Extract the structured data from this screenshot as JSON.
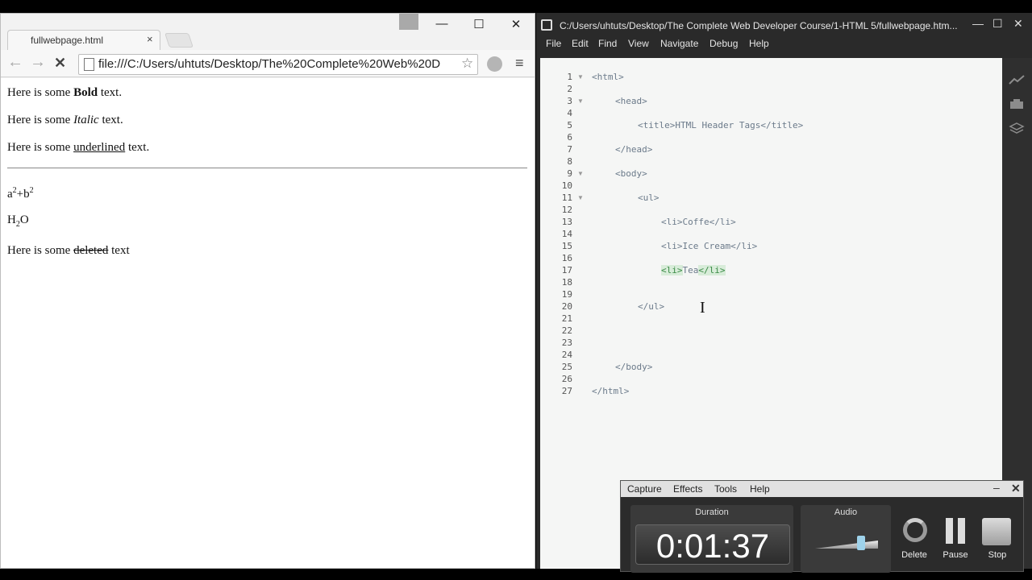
{
  "browser": {
    "tab_title": "fullwebpage.html",
    "tab_close": "×",
    "window_min": "—",
    "window_max": "☐",
    "window_close": "✕",
    "back_icon": "←",
    "forward_icon": "→",
    "stop_icon": "✕",
    "url": "file:///C:/Users/uhtuts/Desktop/The%20Complete%20Web%20D",
    "star_icon": "☆",
    "menu_icon": "≡",
    "page": {
      "bold_pre": "Here is some ",
      "bold_word": "Bold",
      "bold_post": " text.",
      "italic_pre": "Here is some ",
      "italic_word": "Italic",
      "italic_post": " text.",
      "under_pre": "Here is some ",
      "under_word": "underlined",
      "under_post": " text.",
      "sup_a": "a",
      "sup_2a": "2",
      "sup_plus_b": "+b",
      "sup_2b": "2",
      "sub_h": "H",
      "sub_2": "2",
      "sub_o": "O",
      "del_pre": "Here is some ",
      "del_word": "deleted",
      "del_post": " text"
    }
  },
  "editor": {
    "title": "C:/Users/uhtuts/Desktop/The Complete Web Developer Course/1-HTML 5/fullwebpage.htm...",
    "win_min": "—",
    "win_max": "☐",
    "win_close": "✕",
    "menu": [
      "File",
      "Edit",
      "Find",
      "View",
      "Navigate",
      "Debug",
      "Help"
    ],
    "line_numbers": [
      "1",
      "2",
      "3",
      "4",
      "5",
      "6",
      "7",
      "8",
      "9",
      "10",
      "11",
      "12",
      "13",
      "14",
      "15",
      "16",
      "17",
      "18",
      "19",
      "20",
      "21",
      "22",
      "23",
      "24",
      "25",
      "26",
      "27"
    ],
    "code": {
      "l1": "<html>",
      "l3": "<head>",
      "l5": "<title>HTML Header Tags</title>",
      "l7": "</head>",
      "l9": "<body>",
      "l11": "<ul>",
      "l13": "<li>Coffe</li>",
      "l15": "<li>Ice Cream</li>",
      "l17_open": "<li>",
      "l17_text": "Tea",
      "l17_close": "</li>",
      "l20": "</ul>",
      "l25": "</body>",
      "l27": "</html>"
    },
    "fold_icon": "▼"
  },
  "recorder": {
    "menu": [
      "Capture",
      "Effects",
      "Tools",
      "Help"
    ],
    "min": "–",
    "close": "✕",
    "duration_label": "Duration",
    "duration_value": "0:01:37",
    "audio_label": "Audio",
    "delete_label": "Delete",
    "pause_label": "Pause",
    "stop_label": "Stop"
  }
}
